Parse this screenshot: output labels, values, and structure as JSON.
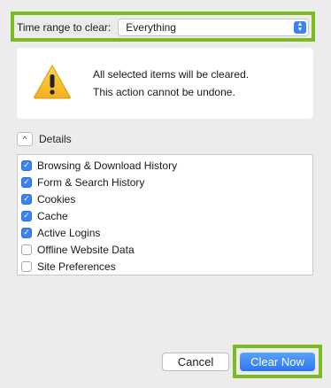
{
  "time_range": {
    "label": "Time range to clear:",
    "selected": "Everything"
  },
  "warning": {
    "icon": "warning-triangle-icon",
    "line1": "All selected items will be cleared.",
    "line2": "This action cannot be undone."
  },
  "details": {
    "label": "Details",
    "toggle_glyph": "^"
  },
  "items": [
    {
      "label": "Browsing & Download History",
      "checked": true
    },
    {
      "label": "Form & Search History",
      "checked": true
    },
    {
      "label": "Cookies",
      "checked": true
    },
    {
      "label": "Cache",
      "checked": true
    },
    {
      "label": "Active Logins",
      "checked": true
    },
    {
      "label": "Offline Website Data",
      "checked": false
    },
    {
      "label": "Site Preferences",
      "checked": false
    }
  ],
  "buttons": {
    "cancel": "Cancel",
    "clear": "Clear Now"
  },
  "colors": {
    "highlight": "#7bbb1f",
    "accent": "#3b82f6"
  }
}
